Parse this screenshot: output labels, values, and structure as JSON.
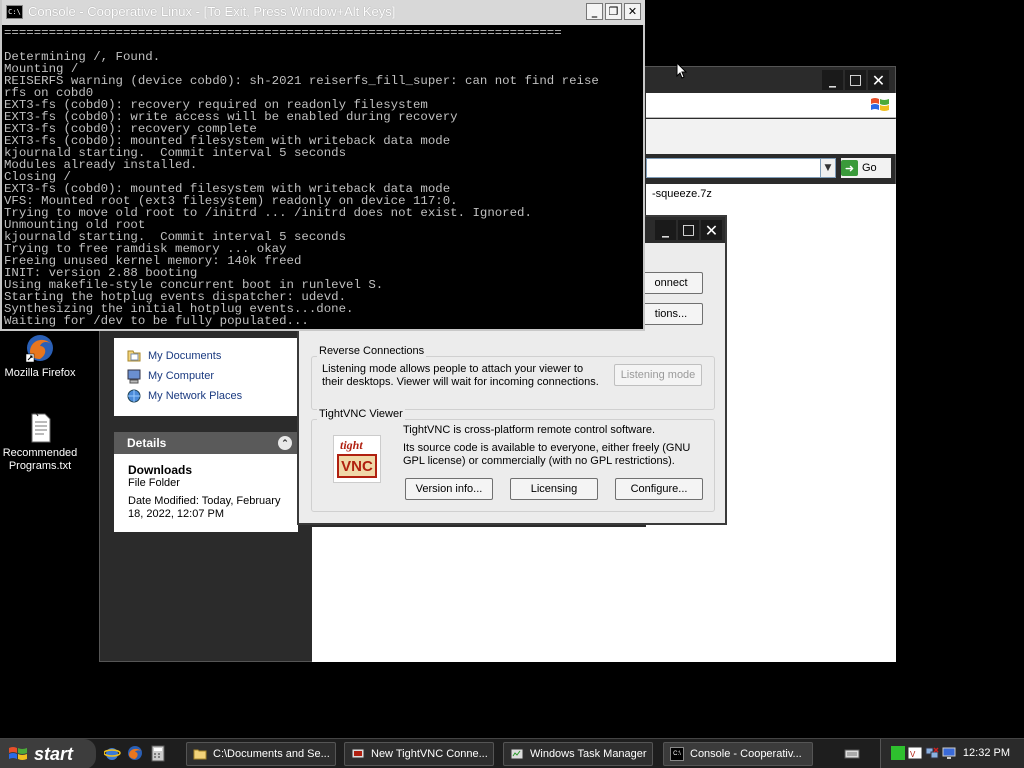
{
  "desktop": {
    "icons": [
      {
        "label": "Mozilla Firefox"
      },
      {
        "label": "Recommended Programs.txt"
      }
    ]
  },
  "explorer": {
    "address_go_label": "Go",
    "file_fragment": "-squeeze.7z",
    "other_places": [
      "My Documents",
      "My Computer",
      "My Network Places"
    ],
    "details": {
      "header": "Details",
      "name": "Downloads",
      "type": "File Folder",
      "modified": "Date Modified: Today, February 18, 2022, 12:07 PM"
    }
  },
  "vnc": {
    "connect_label": "onnect",
    "options_label": "tions...",
    "reverse": {
      "title": "Reverse Connections",
      "text": "Listening mode allows people to attach your viewer to their desktops. Viewer will wait for incoming connections.",
      "listening_label": "Listening mode"
    },
    "viewer": {
      "title": "TightVNC Viewer",
      "line1": "TightVNC is cross-platform remote control software.",
      "line2": "Its source code is available to everyone, either freely (GNU GPL license) or commercially (with no GPL restrictions).",
      "logo_top": "tight",
      "logo_bottom": "VNC",
      "buttons": [
        "Version info...",
        "Licensing",
        "Configure..."
      ]
    }
  },
  "console": {
    "title": "Console - Cooperative Linux - [To Exit, Press Window+Alt Keys]",
    "icon_text": "C:\\",
    "lines": [
      "===========================================================================",
      "",
      "Determining /, Found.",
      "Mounting /",
      "REISERFS warning (device cobd0): sh-2021 reiserfs_fill_super: can not find reise",
      "rfs on cobd0",
      "EXT3-fs (cobd0): recovery required on readonly filesystem",
      "EXT3-fs (cobd0): write access will be enabled during recovery",
      "EXT3-fs (cobd0): recovery complete",
      "EXT3-fs (cobd0): mounted filesystem with writeback data mode",
      "kjournald starting.  Commit interval 5 seconds",
      "Modules already installed.",
      "Closing /",
      "EXT3-fs (cobd0): mounted filesystem with writeback data mode",
      "VFS: Mounted root (ext3 filesystem) readonly on device 117:0.",
      "Trying to move old root to /initrd ... /initrd does not exist. Ignored.",
      "Unmounting old root",
      "kjournald starting.  Commit interval 5 seconds",
      "Trying to free ramdisk memory ... okay",
      "Freeing unused kernel memory: 140k freed",
      "INIT: version 2.88 booting",
      "Using makefile-style concurrent boot in runlevel S.",
      "Starting the hotplug events dispatcher: udevd.",
      "Synthesizing the initial hotplug events...done.",
      "Waiting for /dev to be fully populated..."
    ]
  },
  "taskbar": {
    "start_label": "start",
    "tasks": [
      "C:\\Documents and Se...",
      "New TightVNC Conne...",
      "Windows Task Manager",
      "Console - Cooperativ..."
    ],
    "clock": "12:32 PM"
  }
}
